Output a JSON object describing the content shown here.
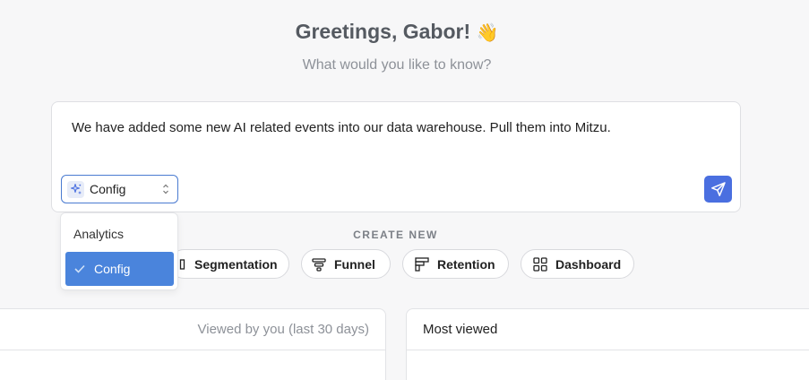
{
  "greeting": {
    "text": "Greetings, Gabor!",
    "emoji": "👋"
  },
  "subtitle": "What would you like to know?",
  "prompt": {
    "text": "We have added some new AI related events into our data warehouse. Pull them into Mitzu.",
    "mode_selected": "Config",
    "mode_icon": "sparkle-icon",
    "send_icon": "send-icon"
  },
  "mode_dropdown": {
    "options": [
      {
        "label": "Analytics",
        "selected": false
      },
      {
        "label": "Config",
        "selected": true
      }
    ]
  },
  "create_new": {
    "heading": "CREATE NEW",
    "items": [
      {
        "label": "Segmentation",
        "icon": "segmentation-icon"
      },
      {
        "label": "Funnel",
        "icon": "funnel-icon"
      },
      {
        "label": "Retention",
        "icon": "retention-icon"
      },
      {
        "label": "Dashboard",
        "icon": "dashboard-icon"
      }
    ]
  },
  "panels": {
    "recent_header": "Viewed by you (last 30 days)",
    "most_viewed_header": "Most viewed"
  },
  "colors": {
    "accent": "#4a6fe0",
    "selected_option": "#4a84dc",
    "select_border": "#4a7bd1",
    "background": "#f7f7f8"
  }
}
